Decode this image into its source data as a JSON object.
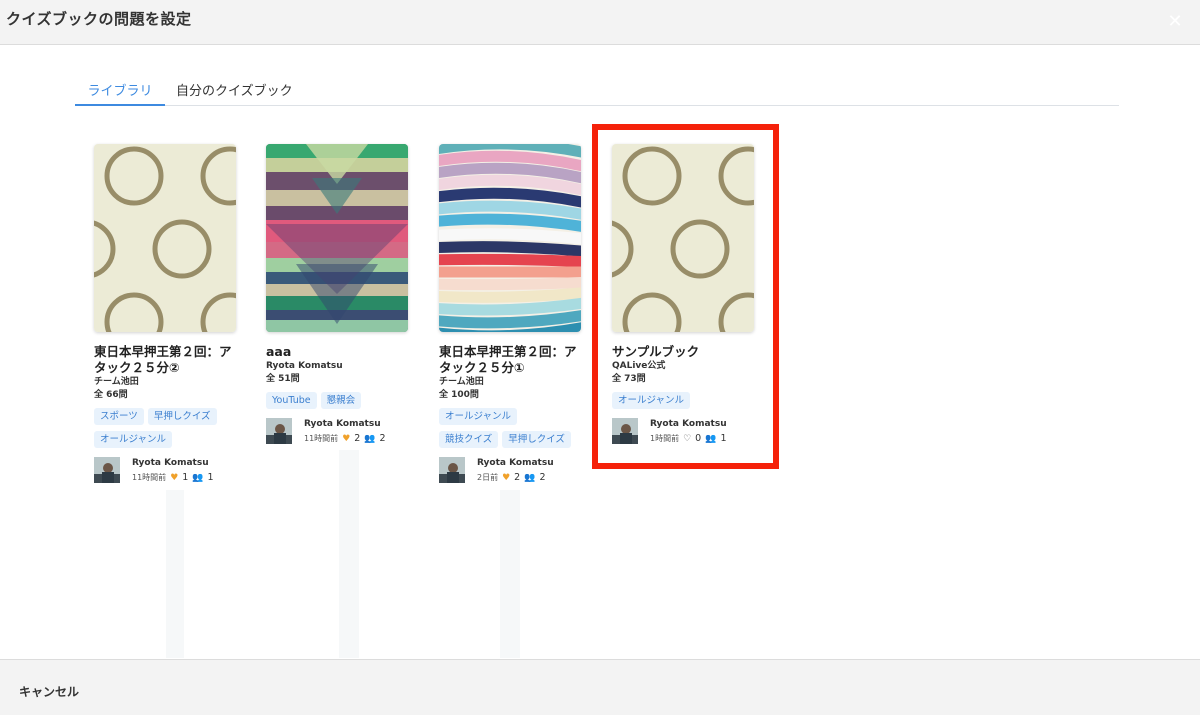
{
  "modal": {
    "title": "クイズブックの問題を設定",
    "close_icon": "close-icon"
  },
  "tabs": [
    {
      "label": "ライブラリ",
      "active": true
    },
    {
      "label": "自分のクイズブック",
      "active": false
    }
  ],
  "cards": [
    {
      "title": "東日本早押王第２回：アタック２５分②",
      "owner": "チーム池田",
      "count": "全 66問",
      "cover": "circles-pattern",
      "tags": [
        "スポーツ",
        "早押しクイズ",
        "オールジャンル"
      ],
      "author": "Ryota Komatsu",
      "time": "11時間前",
      "likes": "1",
      "liked": true,
      "users": "1"
    },
    {
      "title": "aaa",
      "owner": "Ryota Komatsu",
      "count": "全 51問",
      "cover": "triangle-stripes-pattern",
      "tags": [
        "YouTube",
        "懇親会"
      ],
      "author": "Ryota Komatsu",
      "time": "11時間前",
      "likes": "2",
      "liked": true,
      "users": "2"
    },
    {
      "title": "東日本早押王第２回：アタック２５分①",
      "owner": "チーム池田",
      "count": "全 100問",
      "cover": "wave-stripes-pattern",
      "tags": [
        "オールジャンル",
        "競技クイズ",
        "早押しクイズ"
      ],
      "author": "Ryota Komatsu",
      "time": "2日前",
      "likes": "2",
      "liked": true,
      "users": "2"
    },
    {
      "title": "サンプルブック",
      "owner": "QALive公式",
      "count": "全 73問",
      "cover": "circles-pattern",
      "tags": [
        "オールジャンル"
      ],
      "author": "Ryota Komatsu",
      "time": "1時間前",
      "likes": "0",
      "liked": false,
      "users": "1"
    }
  ],
  "footer": {
    "cancel_label": "キャンセル"
  },
  "colors": {
    "accent": "#3d8ae0",
    "highlight": "#f5210a",
    "like": "#f0a12b"
  }
}
